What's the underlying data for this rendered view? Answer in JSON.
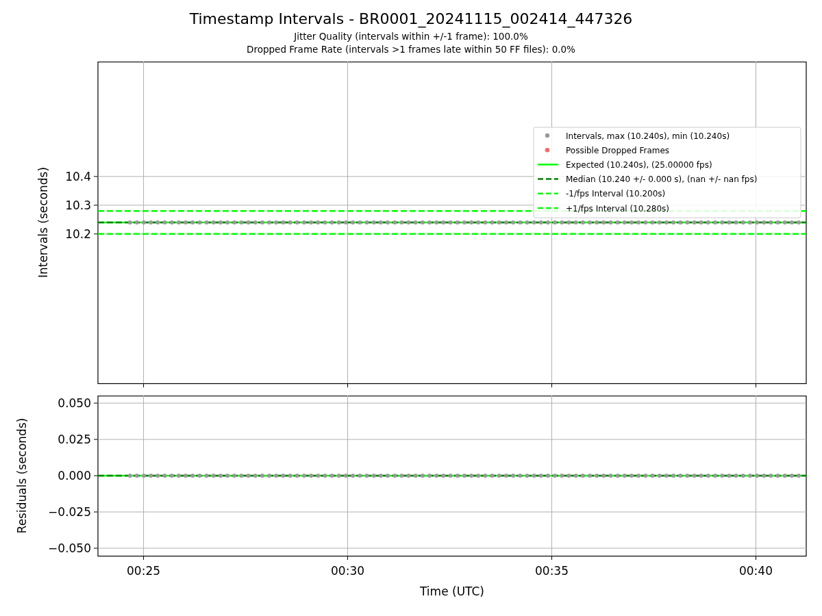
{
  "figure": {
    "title": "Timestamp Intervals - BR0001_20241115_002414_447326",
    "subtitles": [
      "Jitter Quality (intervals within +/-1 frame): 100.0%",
      "Dropped Frame Rate (intervals >1 frames late within 50 FF files): 0.0%"
    ]
  },
  "charts": [
    {
      "chart_data": {
        "type": "scatter",
        "ylabel": "Intervals (seconds)",
        "xlim": [
          1433,
          2474
        ],
        "ylim": [
          9.68,
          10.8
        ],
        "yticks": [
          {
            "value": 10.2,
            "label": "10.2"
          },
          {
            "value": 10.3,
            "label": "10.3"
          },
          {
            "value": 10.4,
            "label": "10.4"
          }
        ],
        "grid": true,
        "legend": true,
        "x": [
          1480,
          1490.24,
          1500.48,
          1510.72,
          1520.96,
          1531.2,
          1541.44,
          1551.68,
          1561.92,
          1572.16,
          1582.4,
          1592.64,
          1602.88,
          1613.12,
          1623.36,
          1633.6,
          1643.84,
          1654.08,
          1664.32,
          1674.56,
          1684.8,
          1695.04,
          1705.28,
          1715.52,
          1725.76,
          1736,
          1746.24,
          1756.48,
          1766.72,
          1776.96,
          1787.2,
          1797.44,
          1807.68,
          1817.92,
          1828.16,
          1838.4,
          1848.64,
          1858.88,
          1869.12,
          1879.36,
          1889.6,
          1899.84,
          1910.08,
          1920.32,
          1930.56,
          1940.8,
          1951.04,
          1961.28,
          1971.52,
          1981.76,
          1992,
          2002.24,
          2012.48,
          2022.72,
          2032.96,
          2043.2,
          2053.44,
          2063.68,
          2073.92,
          2084.16,
          2094.4,
          2104.64,
          2114.88,
          2125.12,
          2135.36,
          2145.6,
          2155.84,
          2166.08,
          2176.32,
          2186.56,
          2196.8,
          2207.04,
          2217.28,
          2227.52,
          2237.76,
          2248,
          2258.24,
          2268.48,
          2278.72,
          2288.96,
          2299.2,
          2309.44,
          2319.68,
          2329.92,
          2340.16,
          2350.4,
          2360.64,
          2370.88,
          2381.12,
          2391.36,
          2401.6,
          2411.84,
          2422.08,
          2432.32,
          2442.56,
          2452.8,
          2463.04
        ],
        "series": [
          {
            "name": "Intervals, max (10.240s), min (10.240s)",
            "color": "#9a9a9a",
            "values": [
              10.24,
              10.24,
              10.24,
              10.24,
              10.24,
              10.24,
              10.24,
              10.24,
              10.24,
              10.24,
              10.24,
              10.24,
              10.24,
              10.24,
              10.24,
              10.24,
              10.24,
              10.24,
              10.24,
              10.24,
              10.24,
              10.24,
              10.24,
              10.24,
              10.24,
              10.24,
              10.24,
              10.24,
              10.24,
              10.24,
              10.24,
              10.24,
              10.24,
              10.24,
              10.24,
              10.24,
              10.24,
              10.24,
              10.24,
              10.24,
              10.24,
              10.24,
              10.24,
              10.24,
              10.24,
              10.24,
              10.24,
              10.24,
              10.24,
              10.24,
              10.24,
              10.24,
              10.24,
              10.24,
              10.24,
              10.24,
              10.24,
              10.24,
              10.24,
              10.24,
              10.24,
              10.24,
              10.24,
              10.24,
              10.24,
              10.24,
              10.24,
              10.24,
              10.24,
              10.24,
              10.24,
              10.24,
              10.24,
              10.24,
              10.24,
              10.24,
              10.24,
              10.24,
              10.24,
              10.24,
              10.24,
              10.24,
              10.24,
              10.24,
              10.24,
              10.24,
              10.24,
              10.24,
              10.24,
              10.24,
              10.24,
              10.24,
              10.24,
              10.24,
              10.24,
              10.24,
              10.24
            ]
          },
          {
            "name": "Possible Dropped Frames",
            "color": "#ff6666",
            "values": [
              null,
              null,
              null,
              null,
              null,
              null,
              null,
              null,
              null,
              null,
              null,
              null,
              null,
              null,
              null,
              null,
              null,
              null,
              null,
              null,
              null,
              null,
              null,
              null,
              null,
              null,
              null,
              null,
              null,
              null,
              null,
              null,
              null,
              null,
              null,
              null,
              null,
              null,
              null,
              null,
              null,
              null,
              null,
              null,
              null,
              null,
              null,
              null,
              null,
              null,
              null,
              null,
              null,
              null,
              null,
              null,
              null,
              null,
              null,
              null,
              null,
              null,
              null,
              null,
              null,
              null,
              null,
              null,
              null,
              null,
              null,
              null,
              null,
              null,
              null,
              null,
              null,
              null,
              null,
              null,
              null,
              null,
              null,
              null,
              null,
              null,
              null,
              null,
              null,
              null,
              null,
              null,
              null,
              null,
              null,
              null,
              null
            ]
          }
        ],
        "ref_lines": [
          {
            "value": 10.24,
            "axis": "y",
            "label": "Expected (10.240s), (25.00000 fps)",
            "color": "#00ff00"
          },
          {
            "value": 10.24,
            "axis": "y",
            "label": "Median (10.240 +/- 0.000 s), (nan +/- nan fps)",
            "color": "#008000"
          },
          {
            "value": 10.2,
            "axis": "y",
            "label": "-1/fps Interval (10.200s)",
            "color": "#00ff00"
          },
          {
            "value": 10.28,
            "axis": "y",
            "label": "+1/fps Interval (10.280s)",
            "color": "#00ff00"
          }
        ]
      }
    },
    {
      "chart_data": {
        "type": "scatter",
        "xlabel": "Time (UTC)",
        "ylabel": "Residuals (seconds)",
        "xlim": [
          1433,
          2474
        ],
        "ylim": [
          -0.0552,
          0.0552
        ],
        "xticks": [
          {
            "value": 1500,
            "label": "00:25"
          },
          {
            "value": 1800,
            "label": "00:30"
          },
          {
            "value": 2100,
            "label": "00:35"
          },
          {
            "value": 2400,
            "label": "00:40"
          }
        ],
        "yticks": [
          {
            "value": -0.05,
            "label": "−0.050"
          },
          {
            "value": -0.025,
            "label": "−0.025"
          },
          {
            "value": 0,
            "label": "0.000"
          },
          {
            "value": 0.025,
            "label": "0.025"
          },
          {
            "value": 0.05,
            "label": "0.050"
          }
        ],
        "x": [
          1480,
          1490.24,
          1500.48,
          1510.72,
          1520.96,
          1531.2,
          1541.44,
          1551.68,
          1561.92,
          1572.16,
          1582.4,
          1592.64,
          1602.88,
          1613.12,
          1623.36,
          1633.6,
          1643.84,
          1654.08,
          1664.32,
          1674.56,
          1684.8,
          1695.04,
          1705.28,
          1715.52,
          1725.76,
          1736,
          1746.24,
          1756.48,
          1766.72,
          1776.96,
          1787.2,
          1797.44,
          1807.68,
          1817.92,
          1828.16,
          1838.4,
          1848.64,
          1858.88,
          1869.12,
          1879.36,
          1889.6,
          1899.84,
          1910.08,
          1920.32,
          1930.56,
          1940.8,
          1951.04,
          1961.28,
          1971.52,
          1981.76,
          1992,
          2002.24,
          2012.48,
          2022.72,
          2032.96,
          2043.2,
          2053.44,
          2063.68,
          2073.92,
          2084.16,
          2094.4,
          2104.64,
          2114.88,
          2125.12,
          2135.36,
          2145.6,
          2155.84,
          2166.08,
          2176.32,
          2186.56,
          2196.8,
          2207.04,
          2217.28,
          2227.52,
          2237.76,
          2248,
          2258.24,
          2268.48,
          2278.72,
          2288.96,
          2299.2,
          2309.44,
          2319.68,
          2329.92,
          2340.16,
          2350.4,
          2360.64,
          2370.88,
          2381.12,
          2391.36,
          2401.6,
          2411.84,
          2422.08,
          2432.32,
          2442.56,
          2452.8,
          2463.04
        ],
        "series": [
          {
            "color": "#9a9a9a",
            "values": [
              0,
              0,
              0,
              0,
              0,
              0,
              0,
              0,
              0,
              0,
              0,
              0,
              0,
              0,
              0,
              0,
              0,
              0,
              0,
              0,
              0,
              0,
              0,
              0,
              0,
              0,
              0,
              0,
              0,
              0,
              0,
              0,
              0,
              0,
              0,
              0,
              0,
              0,
              0,
              0,
              0,
              0,
              0,
              0,
              0,
              0,
              0,
              0,
              0,
              0,
              0,
              0,
              0,
              0,
              0,
              0,
              0,
              0,
              0,
              0,
              0,
              0,
              0,
              0,
              0,
              0,
              0,
              0,
              0,
              0,
              0,
              0,
              0,
              0,
              0,
              0,
              0,
              0,
              0,
              0,
              0,
              0,
              0,
              0,
              0,
              0,
              0,
              0,
              0,
              0,
              0,
              0,
              0,
              0,
              0,
              0,
              0
            ]
          }
        ],
        "grid": true,
        "ref_lines": [
          {
            "value": 0,
            "axis": "y",
            "color": "#00ff00"
          },
          {
            "value": 0,
            "axis": "y",
            "color": "#008000"
          }
        ]
      }
    }
  ]
}
